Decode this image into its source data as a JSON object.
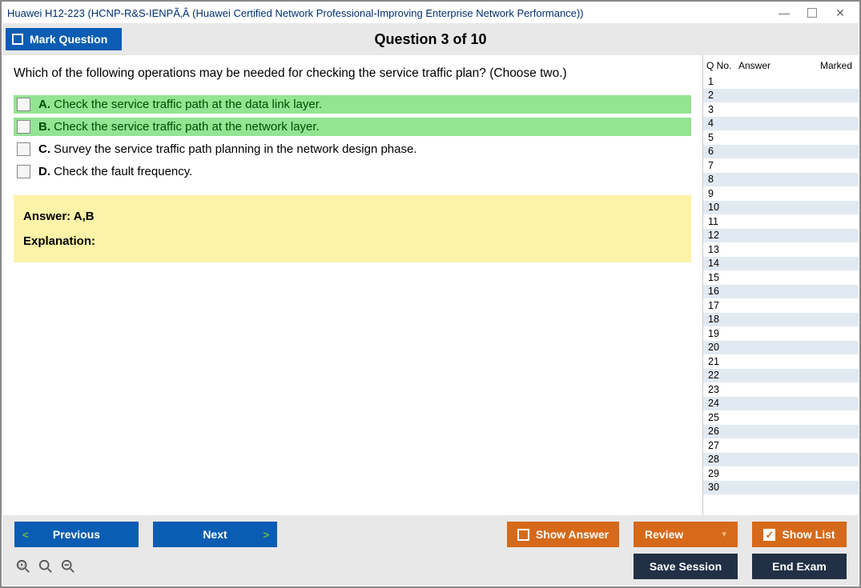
{
  "titlebar": {
    "title": "Huawei H12-223 (HCNP-R&S-IENPÃ‚Â (Huawei Certified Network Professional-Improving Enterprise Network Performance))"
  },
  "header": {
    "mark_label": "Mark Question",
    "counter": "Question 3 of 10"
  },
  "question": {
    "text": "Which of the following operations may be needed for checking the service traffic plan? (Choose two.)",
    "options": [
      {
        "letter": "A.",
        "text": "Check the service traffic path at the data link layer.",
        "correct": true
      },
      {
        "letter": "B.",
        "text": "Check the service traffic path at the network layer.",
        "correct": true
      },
      {
        "letter": "C.",
        "text": "Survey the service traffic path planning in the network design phase.",
        "correct": false
      },
      {
        "letter": "D.",
        "text": "Check the fault frequency.",
        "correct": false
      }
    ],
    "answer_label": "Answer: A,B",
    "explanation_label": "Explanation:"
  },
  "sidebar": {
    "col_qno": "Q No.",
    "col_answer": "Answer",
    "col_marked": "Marked",
    "rows": [
      1,
      2,
      3,
      4,
      5,
      6,
      7,
      8,
      9,
      10,
      11,
      12,
      13,
      14,
      15,
      16,
      17,
      18,
      19,
      20,
      21,
      22,
      23,
      24,
      25,
      26,
      27,
      28,
      29,
      30
    ]
  },
  "footer": {
    "previous": "Previous",
    "next": "Next",
    "show_answer": "Show Answer",
    "review": "Review",
    "show_list": "Show List",
    "save_session": "Save Session",
    "end_exam": "End Exam"
  }
}
